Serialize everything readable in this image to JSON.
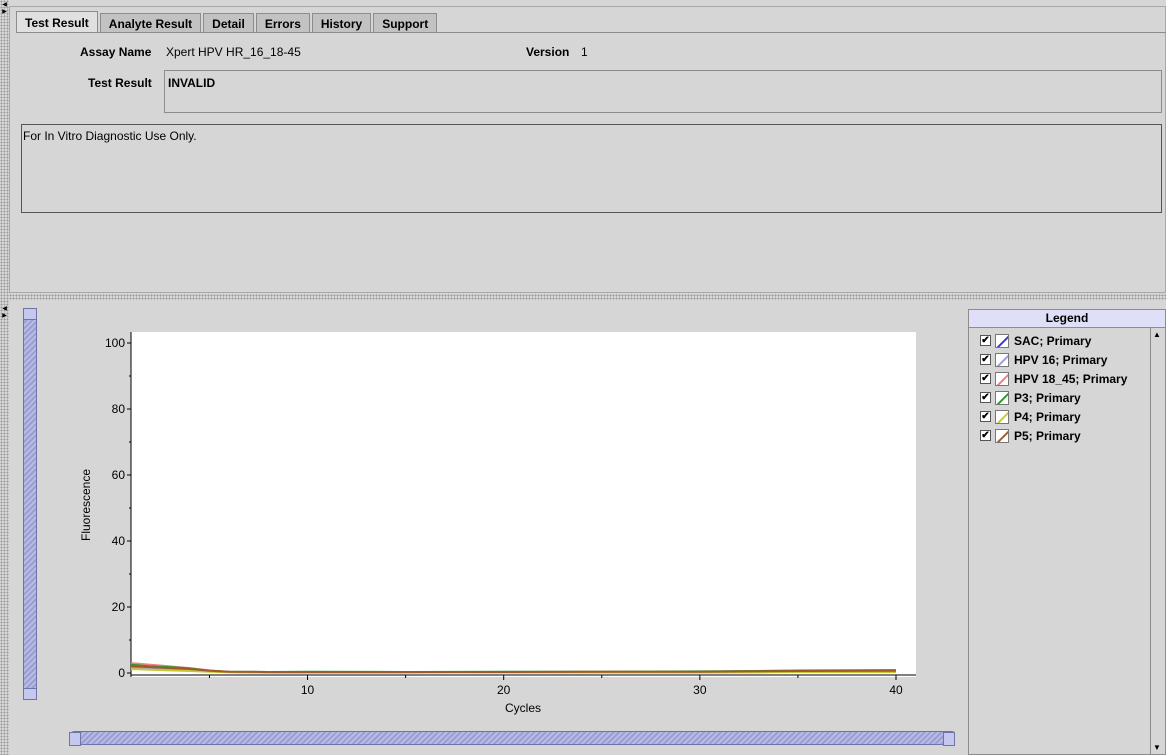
{
  "tabs": [
    "Test Result",
    "Analyte Result",
    "Detail",
    "Errors",
    "History",
    "Support"
  ],
  "assay": {
    "name_label": "Assay Name",
    "name_value": "Xpert HPV HR_16_18-45",
    "version_label": "Version",
    "version_value": "1"
  },
  "test_result": {
    "label": "Test Result",
    "value": "INVALID"
  },
  "notes": "For In Vitro Diagnostic Use Only.",
  "legend": {
    "title": "Legend",
    "items": [
      {
        "label": "SAC; Primary",
        "color": "#3a3acc"
      },
      {
        "label": "HPV 16; Primary",
        "color": "#9c9cde"
      },
      {
        "label": "HPV 18_45; Primary",
        "color": "#f08080"
      },
      {
        "label": "P3; Primary",
        "color": "#2e9a2e"
      },
      {
        "label": "P4; Primary",
        "color": "#c8c830"
      },
      {
        "label": "P5; Primary",
        "color": "#a05a2c"
      }
    ]
  },
  "chart_data": {
    "type": "line",
    "xlabel": "Cycles",
    "ylabel": "Fluorescence",
    "xlim": [
      1,
      40
    ],
    "ylim": [
      0,
      100
    ],
    "xticks": [
      10,
      20,
      30,
      40
    ],
    "yticks": [
      0,
      20,
      40,
      60,
      80,
      100
    ],
    "x": [
      1,
      2,
      3,
      4,
      5,
      6,
      8,
      10,
      15,
      20,
      25,
      30,
      35,
      40
    ],
    "series": [
      {
        "name": "SAC; Primary",
        "color": "#3a3acc",
        "values": [
          2.0,
          1.5,
          1.2,
          1.0,
          0.6,
          0.3,
          0.2,
          0.2,
          0.2,
          0.2,
          0.2,
          0.2,
          0.3,
          0.4
        ]
      },
      {
        "name": "HPV 16; Primary",
        "color": "#9c9cde",
        "values": [
          1.5,
          1.2,
          1.0,
          0.8,
          0.5,
          0.3,
          0.2,
          0.2,
          0.2,
          0.2,
          0.2,
          0.3,
          0.3,
          0.3
        ]
      },
      {
        "name": "HPV 18_45; Primary",
        "color": "#f08080",
        "values": [
          3.0,
          2.5,
          2.0,
          1.5,
          0.8,
          0.4,
          0.3,
          0.3,
          0.3,
          0.3,
          0.4,
          0.4,
          0.8,
          0.9
        ]
      },
      {
        "name": "P3; Primary",
        "color": "#2e9a2e",
        "values": [
          2.5,
          2.0,
          1.8,
          1.4,
          0.7,
          0.4,
          0.3,
          0.4,
          0.3,
          0.4,
          0.4,
          0.5,
          0.7,
          0.8
        ]
      },
      {
        "name": "P4; Primary",
        "color": "#c8c830",
        "values": [
          1.2,
          1.0,
          0.8,
          0.6,
          0.4,
          0.2,
          0.1,
          0.1,
          0.1,
          0.2,
          0.2,
          0.2,
          0.3,
          0.3
        ]
      },
      {
        "name": "P5; Primary",
        "color": "#a05a2c",
        "values": [
          2.2,
          1.8,
          1.5,
          1.2,
          0.7,
          0.4,
          0.3,
          0.3,
          0.3,
          0.3,
          0.4,
          0.4,
          0.6,
          0.7
        ]
      }
    ]
  }
}
